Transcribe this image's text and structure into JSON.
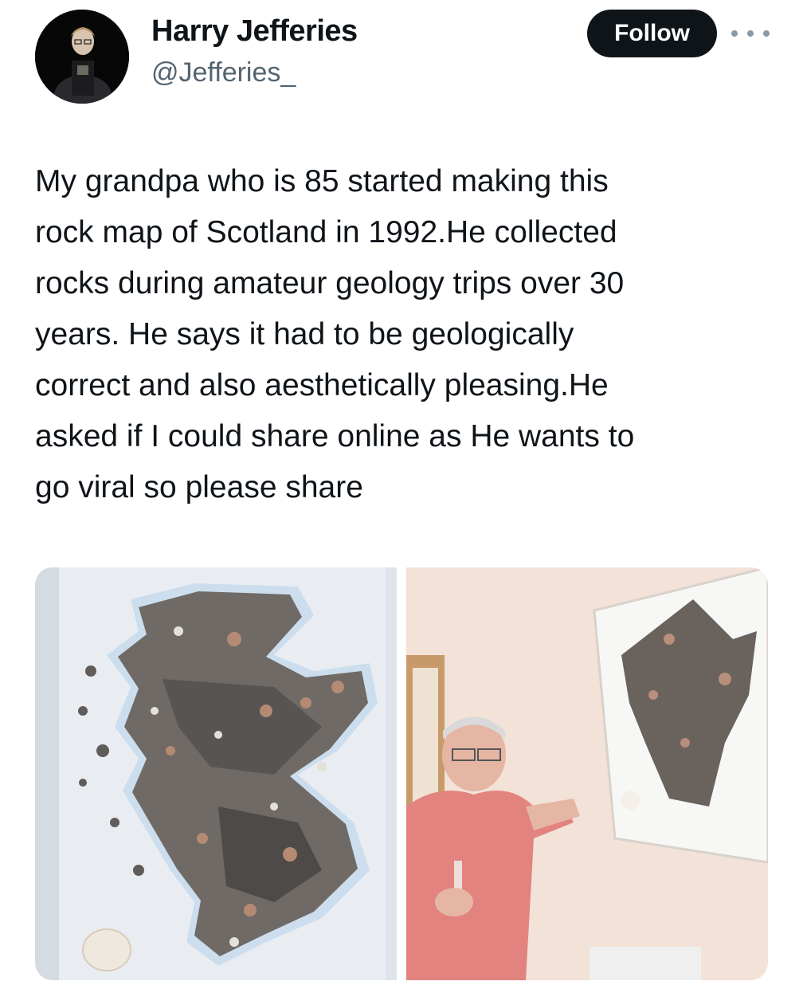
{
  "author": {
    "name": "Harry Jefferies",
    "handle": "@Jefferies_",
    "avatar_icon": "profile-photo"
  },
  "actions": {
    "follow_label": "Follow",
    "more_icon": "more-options-icon"
  },
  "tweet": {
    "text": "My grandpa who is 85 started making this\nrock map of Scotland in 1992.He collected\nrocks during amateur geology trips over 30\nyears. He says it had to be geologically\ncorrect and also aesthetically pleasing.He\nasked if I could share online as He wants to\ngo viral so please share"
  },
  "colors": {
    "text": "#0f1419",
    "secondary": "#536471",
    "button_bg": "#0f1419",
    "button_text": "#ffffff"
  }
}
